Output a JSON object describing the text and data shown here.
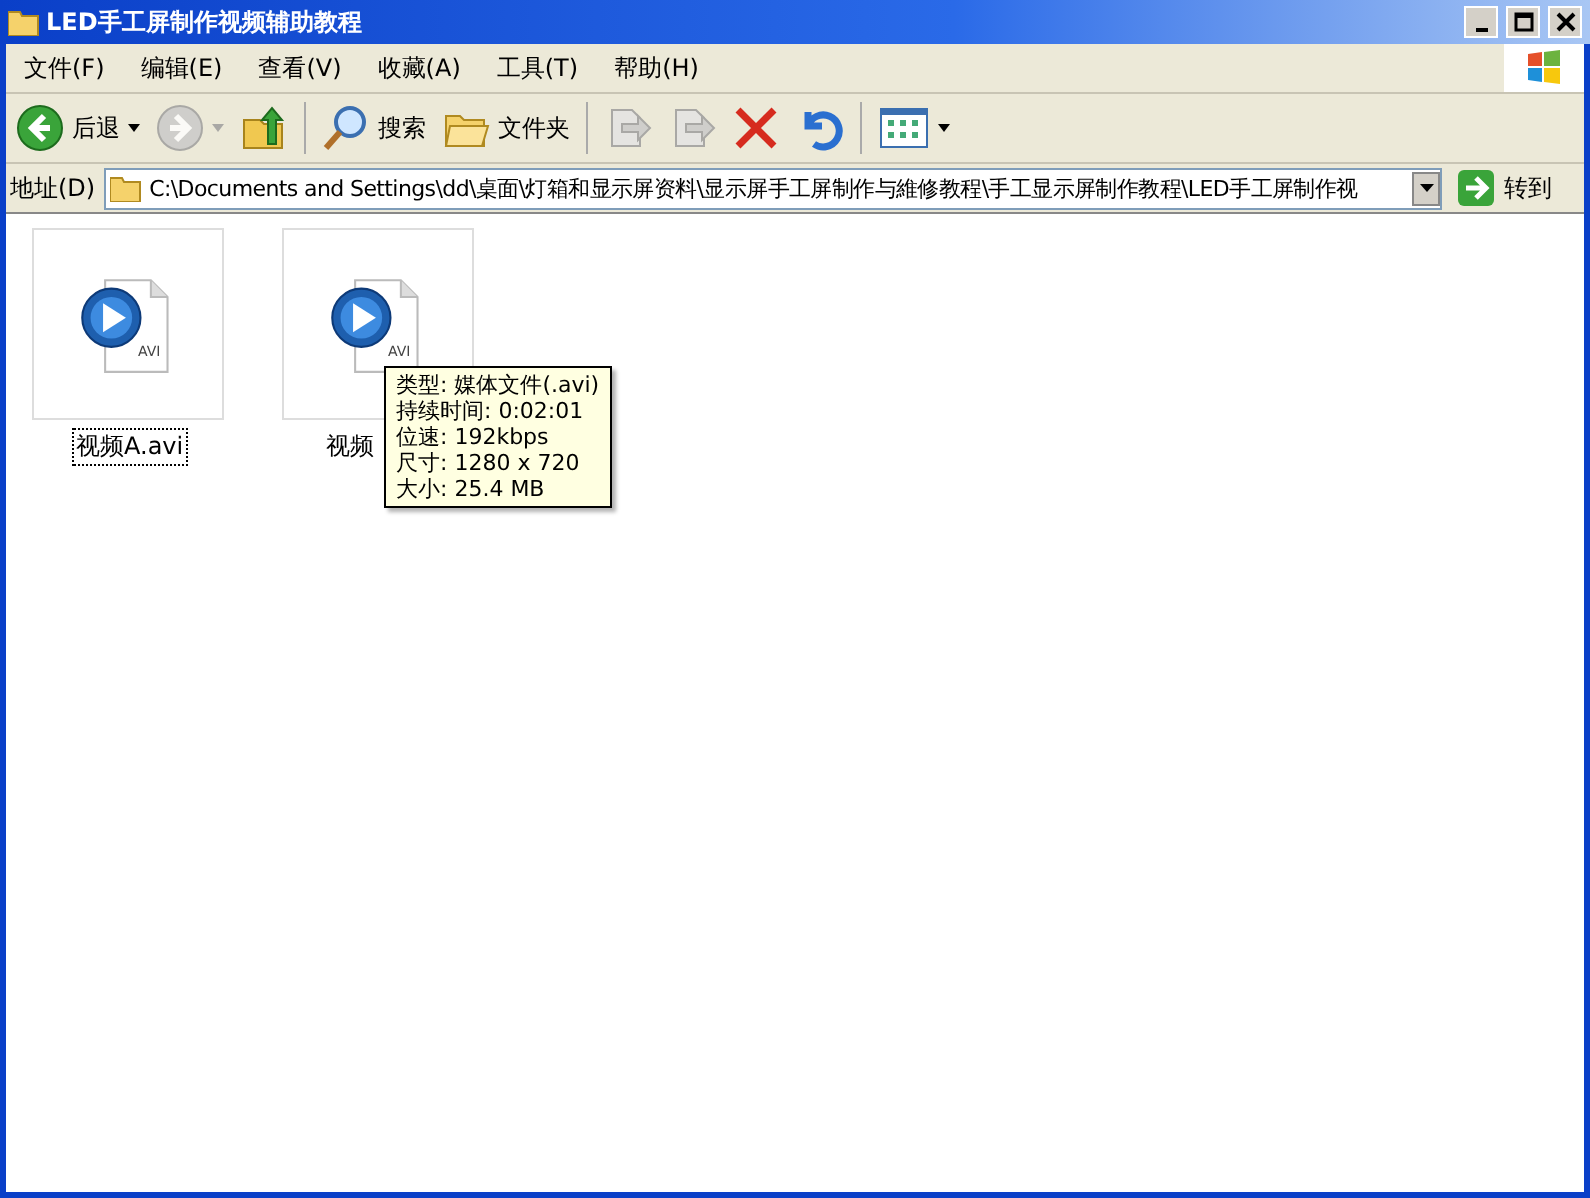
{
  "window": {
    "title": "LED手工屏制作视频辅助教程"
  },
  "menu": [
    "文件(F)",
    "编辑(E)",
    "查看(V)",
    "收藏(A)",
    "工具(T)",
    "帮助(H)"
  ],
  "toolbar": [
    {
      "kind": "back",
      "label": "后退",
      "disabled": false
    },
    {
      "kind": "forward",
      "disabled": true
    },
    {
      "kind": "up",
      "disabled": false
    },
    {
      "kind": "sep"
    },
    {
      "kind": "search",
      "label": "搜索",
      "disabled": false
    },
    {
      "kind": "folders",
      "label": "文件夹",
      "disabled": false
    },
    {
      "kind": "sep"
    },
    {
      "kind": "move",
      "disabled": true
    },
    {
      "kind": "copy",
      "disabled": true
    },
    {
      "kind": "delete",
      "disabled": false
    },
    {
      "kind": "undo",
      "disabled": false
    },
    {
      "kind": "sep"
    },
    {
      "kind": "views",
      "disabled": false
    }
  ],
  "address": {
    "label": "地址(D)",
    "value": "C:\\Documents and Settings\\dd\\桌面\\灯箱和显示屏资料\\显示屏手工屏制作与維修教程\\手工显示屏制作教程\\LED手工屏制作视",
    "go": "转到"
  },
  "files": [
    {
      "name": "视频A.avi",
      "badge": "AVI",
      "selected": true
    },
    {
      "name": "视频",
      "badge": "AVI",
      "selected": false
    }
  ],
  "tooltip": [
    "类型: 媒体文件(.avi)",
    "持续时间: 0:02:01",
    "位速: 192kbps",
    "尺寸: 1280 x 720",
    "大小: 25.4 MB"
  ]
}
